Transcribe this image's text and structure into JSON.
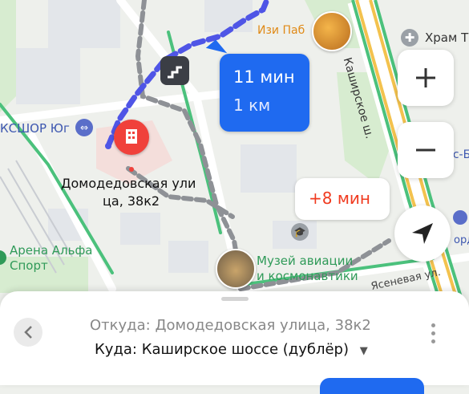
{
  "map": {
    "labels": {
      "pub": "Изи Паб",
      "street_kashirskoe": "Каширское ш.",
      "temple": "Храм Т",
      "sport_school": "КСШОР Юг",
      "destination_line1": "Домодедовская ули",
      "destination_line2": "ца, 38к2",
      "arena_line1": "Арена Альфа",
      "arena_line2": "Спорт",
      "museum_line1": "Музей авиации",
      "museum_line2": "и космонавтики",
      "street_yasenevaya": "Ясеневая ул.",
      "right_edge_poi": "Гус-Б",
      "right_edge_poi2": "ордео"
    },
    "route_main": {
      "time": "11 мин",
      "distance": "1 км"
    },
    "route_alt": {
      "delta": "+8 мин"
    },
    "colors": {
      "route": "#4f55e6",
      "accent": "#1f6af0",
      "alt_delta": "#f03a1f",
      "poi_green": "#2f9a58",
      "pin": "#f0413b"
    }
  },
  "controls": {
    "zoom_in": "zoom-in",
    "zoom_out": "zoom-out",
    "locate": "locate-me"
  },
  "sheet": {
    "from": "Откуда: Домодедовская улица, 38к2",
    "to": "Куда: Каширское шоссе (дублёр)"
  }
}
